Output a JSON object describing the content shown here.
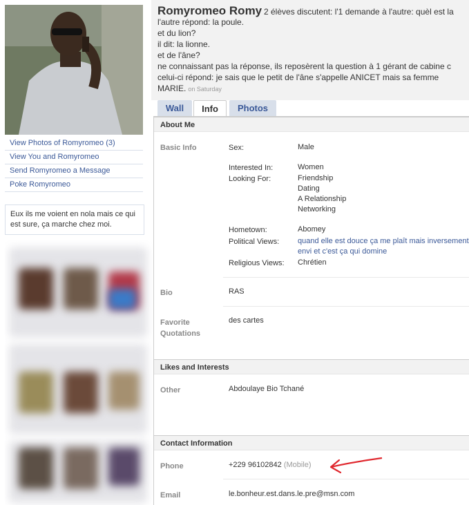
{
  "profile": {
    "name": "Romyromeo Romy",
    "status_first": "2 élèves discutent: l'1 demande à l'autre: quèl est la",
    "status_lines": [
      "l'autre répond: la poule.",
      "et du lion?",
      "il dit: la lionne.",
      "et de l'âne?",
      "ne connaissant pas la réponse, ils reposèrent la question à 1 gérant de cabine c",
      "celui-ci répond: je sais que le petit de l'âne s'appelle ANICET mais sa femme",
      "MARIE."
    ],
    "status_time": "on Saturday"
  },
  "left_links": [
    "View Photos of Romyromeo (3)",
    "View You and Romyromeo",
    "Send Romyromeo a Message",
    "Poke Romyromeo"
  ],
  "status_box": "Eux ils me voient en nola mais ce qui est sure, ça marche chez moi.",
  "tabs": [
    "Wall",
    "Info",
    "Photos"
  ],
  "sections": {
    "about": "About Me",
    "likes": "Likes and Interests",
    "contact": "Contact Information"
  },
  "basic_info": {
    "label": "Basic Info",
    "sex_key": "Sex:",
    "sex": "Male",
    "interested_key": "Interested In:",
    "interested": "Women",
    "looking_key": "Looking For:",
    "looking": [
      "Friendship",
      "Dating",
      "A Relationship",
      "Networking"
    ],
    "hometown_key": "Hometown:",
    "hometown": "Abomey",
    "political_key": "Political Views:",
    "political": [
      "quand elle est douce ça me plaît mais inversement j'",
      "envi et c'est ça qui domine"
    ],
    "religious_key": "Religious Views:",
    "religious": "Chrétien"
  },
  "bio": {
    "label": "Bio",
    "value": "RAS"
  },
  "quotes": {
    "label_1": "Favorite",
    "label_2": "Quotations",
    "value": "des cartes"
  },
  "likes": {
    "label": "Other",
    "value": "Abdoulaye Bio Tchané"
  },
  "contact": {
    "phone_label": "Phone",
    "phone": "+229 96102842",
    "phone_type": "(Mobile)",
    "email_label": "Email",
    "email": "le.bonheur.est.dans.le.pre@msn.com"
  },
  "colors": {
    "link": "#3b5998",
    "arrow": "#e0282e",
    "tab_bg": "#d8dfea"
  },
  "icons": {
    "arrow": "red-arrow-annotation"
  }
}
